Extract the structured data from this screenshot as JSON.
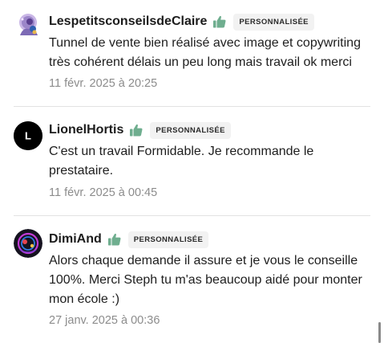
{
  "reviews": [
    {
      "author": "LespetitsconseilsdeClaire",
      "badge": "PERSONNALISÉE",
      "avatar_icon": "stylized-head-avatar",
      "text": "Tunnel de vente bien réalisé avec image et copywriting très cohérent délais un peu long mais travail ok merci",
      "date": "11 févr. 2025 à 20:25"
    },
    {
      "author": "LionelHortis",
      "badge": "PERSONNALISÉE",
      "avatar_letter": "L",
      "avatar_icon": "letter-avatar",
      "text": "C'est un travail Formidable. Je recommande le prestataire.",
      "date": "11 févr. 2025 à 00:45"
    },
    {
      "author": "DimiAnd",
      "badge": "PERSONNALISÉE",
      "avatar_icon": "neon-circle-avatar",
      "text": "Alors chaque demande il assure et je vous le conseille 100%. Merci Steph tu m'as beaucoup aidé pour monter mon école :)",
      "date": "27 janv. 2025 à 00:36"
    }
  ],
  "colors": {
    "thumb": "#6fae8f",
    "badge_bg": "#f2f2f2",
    "date": "#8c8c8c",
    "divider": "#e2e2e2"
  },
  "icons": {
    "rating": "thumbs-up-icon"
  }
}
